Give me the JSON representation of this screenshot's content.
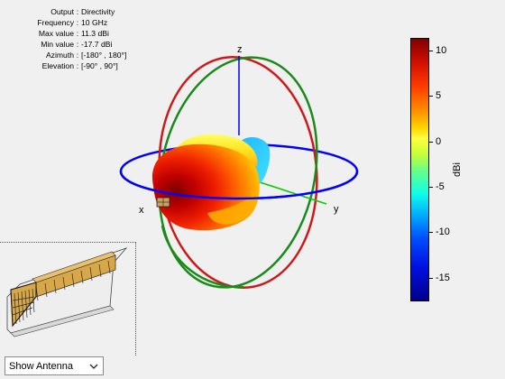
{
  "info": [
    {
      "label": "Output",
      "value": "Directivity"
    },
    {
      "label": "Frequency",
      "value": "10 GHz"
    },
    {
      "label": "Max value",
      "value": "11.3 dBi"
    },
    {
      "label": "Min value",
      "value": "-17.7 dBi"
    },
    {
      "label": "Azimuth",
      "value": "[-180° , 180°]"
    },
    {
      "label": "Elevation",
      "value": "[-90° , 90°]"
    }
  ],
  "info_separator": ":",
  "axes": {
    "x": "x",
    "y": "y",
    "z": "z"
  },
  "colorbar": {
    "unit": "dBi",
    "ticks": [
      "10",
      "5",
      "0",
      "-5",
      "-10",
      "-15"
    ],
    "range": [
      -17.7,
      11.3
    ]
  },
  "view_select": {
    "value": "Show Antenna"
  },
  "icons": {
    "dropdown": "chevron-down-icon",
    "antenna": "horn-antenna-icon"
  },
  "colors": {
    "azimuth_circle": "#0000ff",
    "elevation_circle_xz": "#cc1a1a",
    "elevation_circle_yz": "#1a8a1a",
    "z_axis": "#0000ff",
    "y_axis": "#00cc00"
  }
}
